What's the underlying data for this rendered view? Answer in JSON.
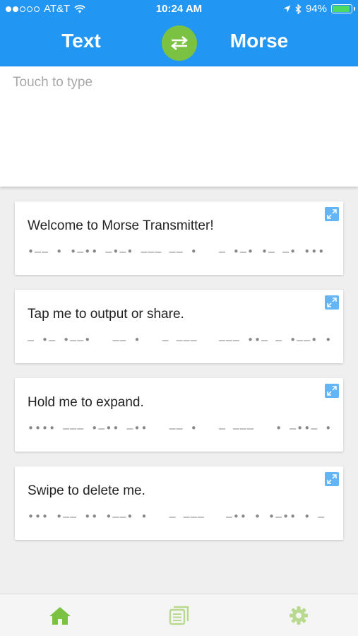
{
  "status_bar": {
    "carrier": "AT&T",
    "time": "10:24 AM",
    "battery_percent": "94%",
    "battery_level": 0.94,
    "signal_bars_filled": 2,
    "signal_bars_total": 5
  },
  "header": {
    "left_label": "Text",
    "right_label": "Morse",
    "swap_icon": "swap-arrows-icon"
  },
  "input": {
    "placeholder": "Touch to type",
    "value": ""
  },
  "cards": [
    {
      "title": "Welcome to Morse Transmitter!",
      "morse": "•—— • •—•• —•—• ——— —— •   — •—• •— —• ••• —— •• — — • •—• —•—•——"
    },
    {
      "title": "Tap me to output or share.",
      "morse": "— •— •——•   —— •   — ———   ——— ••— — •——• ••— —   ——— •—•   ••• •••• •— •—• • •—•—•—"
    },
    {
      "title": "Hold me to expand.",
      "morse": "•••• ——— •—•• —••   —— •   — ———   • —••— •——• •— —• —•• •—•—•—"
    },
    {
      "title": "Swipe to delete me.",
      "morse": "••• •—— •• •——• •   — ———   —•• • •—•• • — •   —— • •—•—•—"
    }
  ],
  "tab_bar": {
    "active_tab": "home",
    "active_color": "#7cc242",
    "inactive_color": "#b9d98f",
    "tabs": [
      "home-icon",
      "history-icon",
      "gear-icon"
    ]
  },
  "colors": {
    "primary_blue": "#2196f3",
    "accent_green": "#7cc242",
    "background": "#efefef"
  }
}
